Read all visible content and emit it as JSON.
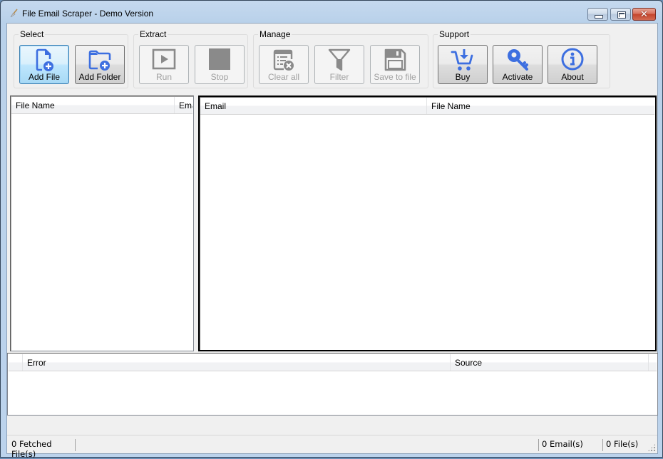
{
  "window": {
    "title": "File Email Scraper - Demo Version",
    "controls": {
      "minimize": "minimize",
      "maximize": "maximize",
      "close": "✕"
    }
  },
  "toolbar": {
    "groups": [
      {
        "label": "Select",
        "buttons": [
          {
            "label": "Add File",
            "icon": "add-file-icon",
            "state": "active"
          },
          {
            "label": "Add Folder",
            "icon": "add-folder-icon",
            "state": "enabled"
          }
        ]
      },
      {
        "label": "Extract",
        "buttons": [
          {
            "label": "Run",
            "icon": "play-icon",
            "state": "disabled"
          },
          {
            "label": "Stop",
            "icon": "stop-icon",
            "state": "disabled"
          }
        ]
      },
      {
        "label": "Manage",
        "buttons": [
          {
            "label": "Clear all",
            "icon": "clear-list-icon",
            "state": "disabled"
          },
          {
            "label": "Filter",
            "icon": "filter-icon",
            "state": "disabled"
          },
          {
            "label": "Save to file",
            "icon": "save-icon",
            "state": "disabled"
          }
        ]
      },
      {
        "label": "Support",
        "buttons": [
          {
            "label": "Buy",
            "icon": "cart-icon",
            "state": "enabled"
          },
          {
            "label": "Activate",
            "icon": "key-icon",
            "state": "enabled"
          },
          {
            "label": "About",
            "icon": "info-icon",
            "state": "enabled"
          }
        ]
      }
    ]
  },
  "files_list": {
    "columns": [
      "File Name",
      "Ema"
    ],
    "rows": []
  },
  "emails_list": {
    "columns": [
      "Email",
      "File Name"
    ],
    "rows": []
  },
  "errors_list": {
    "columns": [
      "",
      "Error",
      "Source",
      ""
    ],
    "rows": []
  },
  "statusbar": {
    "fetched": "0 Fetched File(s)",
    "emails": "0 Email(s)",
    "files": "0 File(s)"
  },
  "colors": {
    "icon_accent": "#3d6fe0",
    "icon_disabled": "#8a8a8a"
  }
}
